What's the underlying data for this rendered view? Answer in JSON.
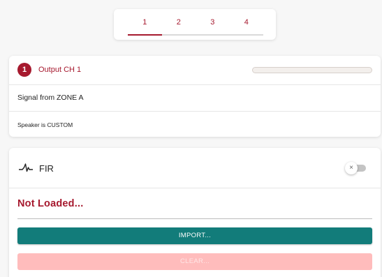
{
  "channel_tabs": [
    "1",
    "2",
    "3",
    "4"
  ],
  "active_tab_index": 0,
  "output": {
    "channel_number": "1",
    "title": "Output CH 1",
    "level_fraction": 0.0,
    "signal_text": "Signal from ZONE A",
    "speaker_text": "Speaker is CUSTOM"
  },
  "fir": {
    "title": "FIR",
    "icon": "waveform-pulse-icon",
    "enabled": false,
    "toggle_glyph": "×",
    "status": "Not Loaded...",
    "import_label": "IMPORT...",
    "clear_label": "CLEAR..."
  },
  "colors": {
    "accent": "#a6192e",
    "import_button": "#127c7a",
    "clear_button_disabled": "#ffbcbc"
  }
}
